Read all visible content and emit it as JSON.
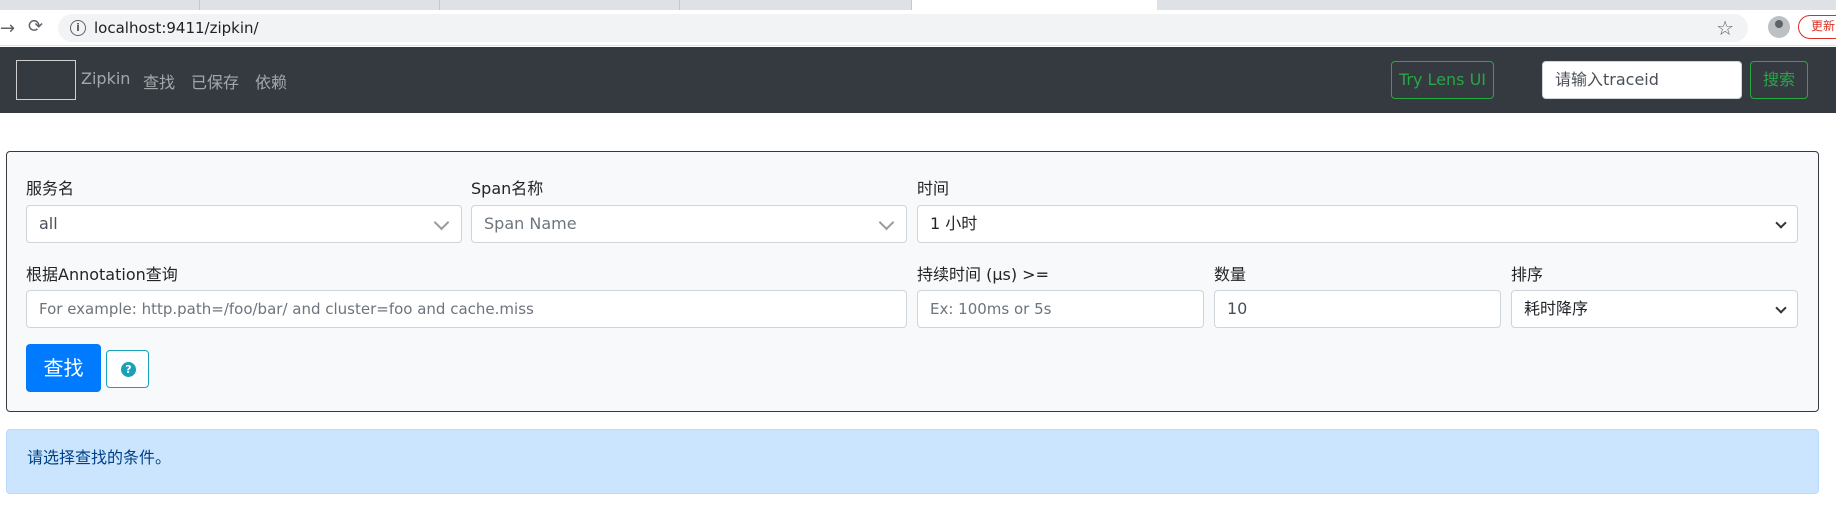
{
  "browser": {
    "url": "localhost:9411/zipkin/",
    "update_label": "更新"
  },
  "navbar": {
    "brand": "Zipkin",
    "links": [
      "查找",
      "已保存",
      "依赖"
    ],
    "lens_button": "Try Lens UI",
    "traceid_placeholder": "请输入traceid",
    "search_button": "搜索"
  },
  "form": {
    "service_label": "服务名",
    "service_value": "all",
    "span_label": "Span名称",
    "span_placeholder": "Span Name",
    "time_label": "时间",
    "time_value": "1 小时",
    "annotation_label": "根据Annotation查询",
    "annotation_placeholder": "For example: http.path=/foo/bar/ and cluster=foo and cache.miss",
    "duration_label": "持续时间 (μs) >=",
    "duration_placeholder": "Ex: 100ms or 5s",
    "limit_label": "数量",
    "limit_value": "10",
    "sort_label": "排序",
    "sort_value": "耗时降序",
    "find_button": "查找",
    "help_glyph": "?"
  },
  "alert": {
    "message": "请选择查找的条件。"
  },
  "colors": {
    "navbar_bg": "#343a40",
    "success": "#28a745",
    "primary": "#007bff",
    "info": "#17a2b8",
    "alert_bg": "#cce5ff"
  }
}
